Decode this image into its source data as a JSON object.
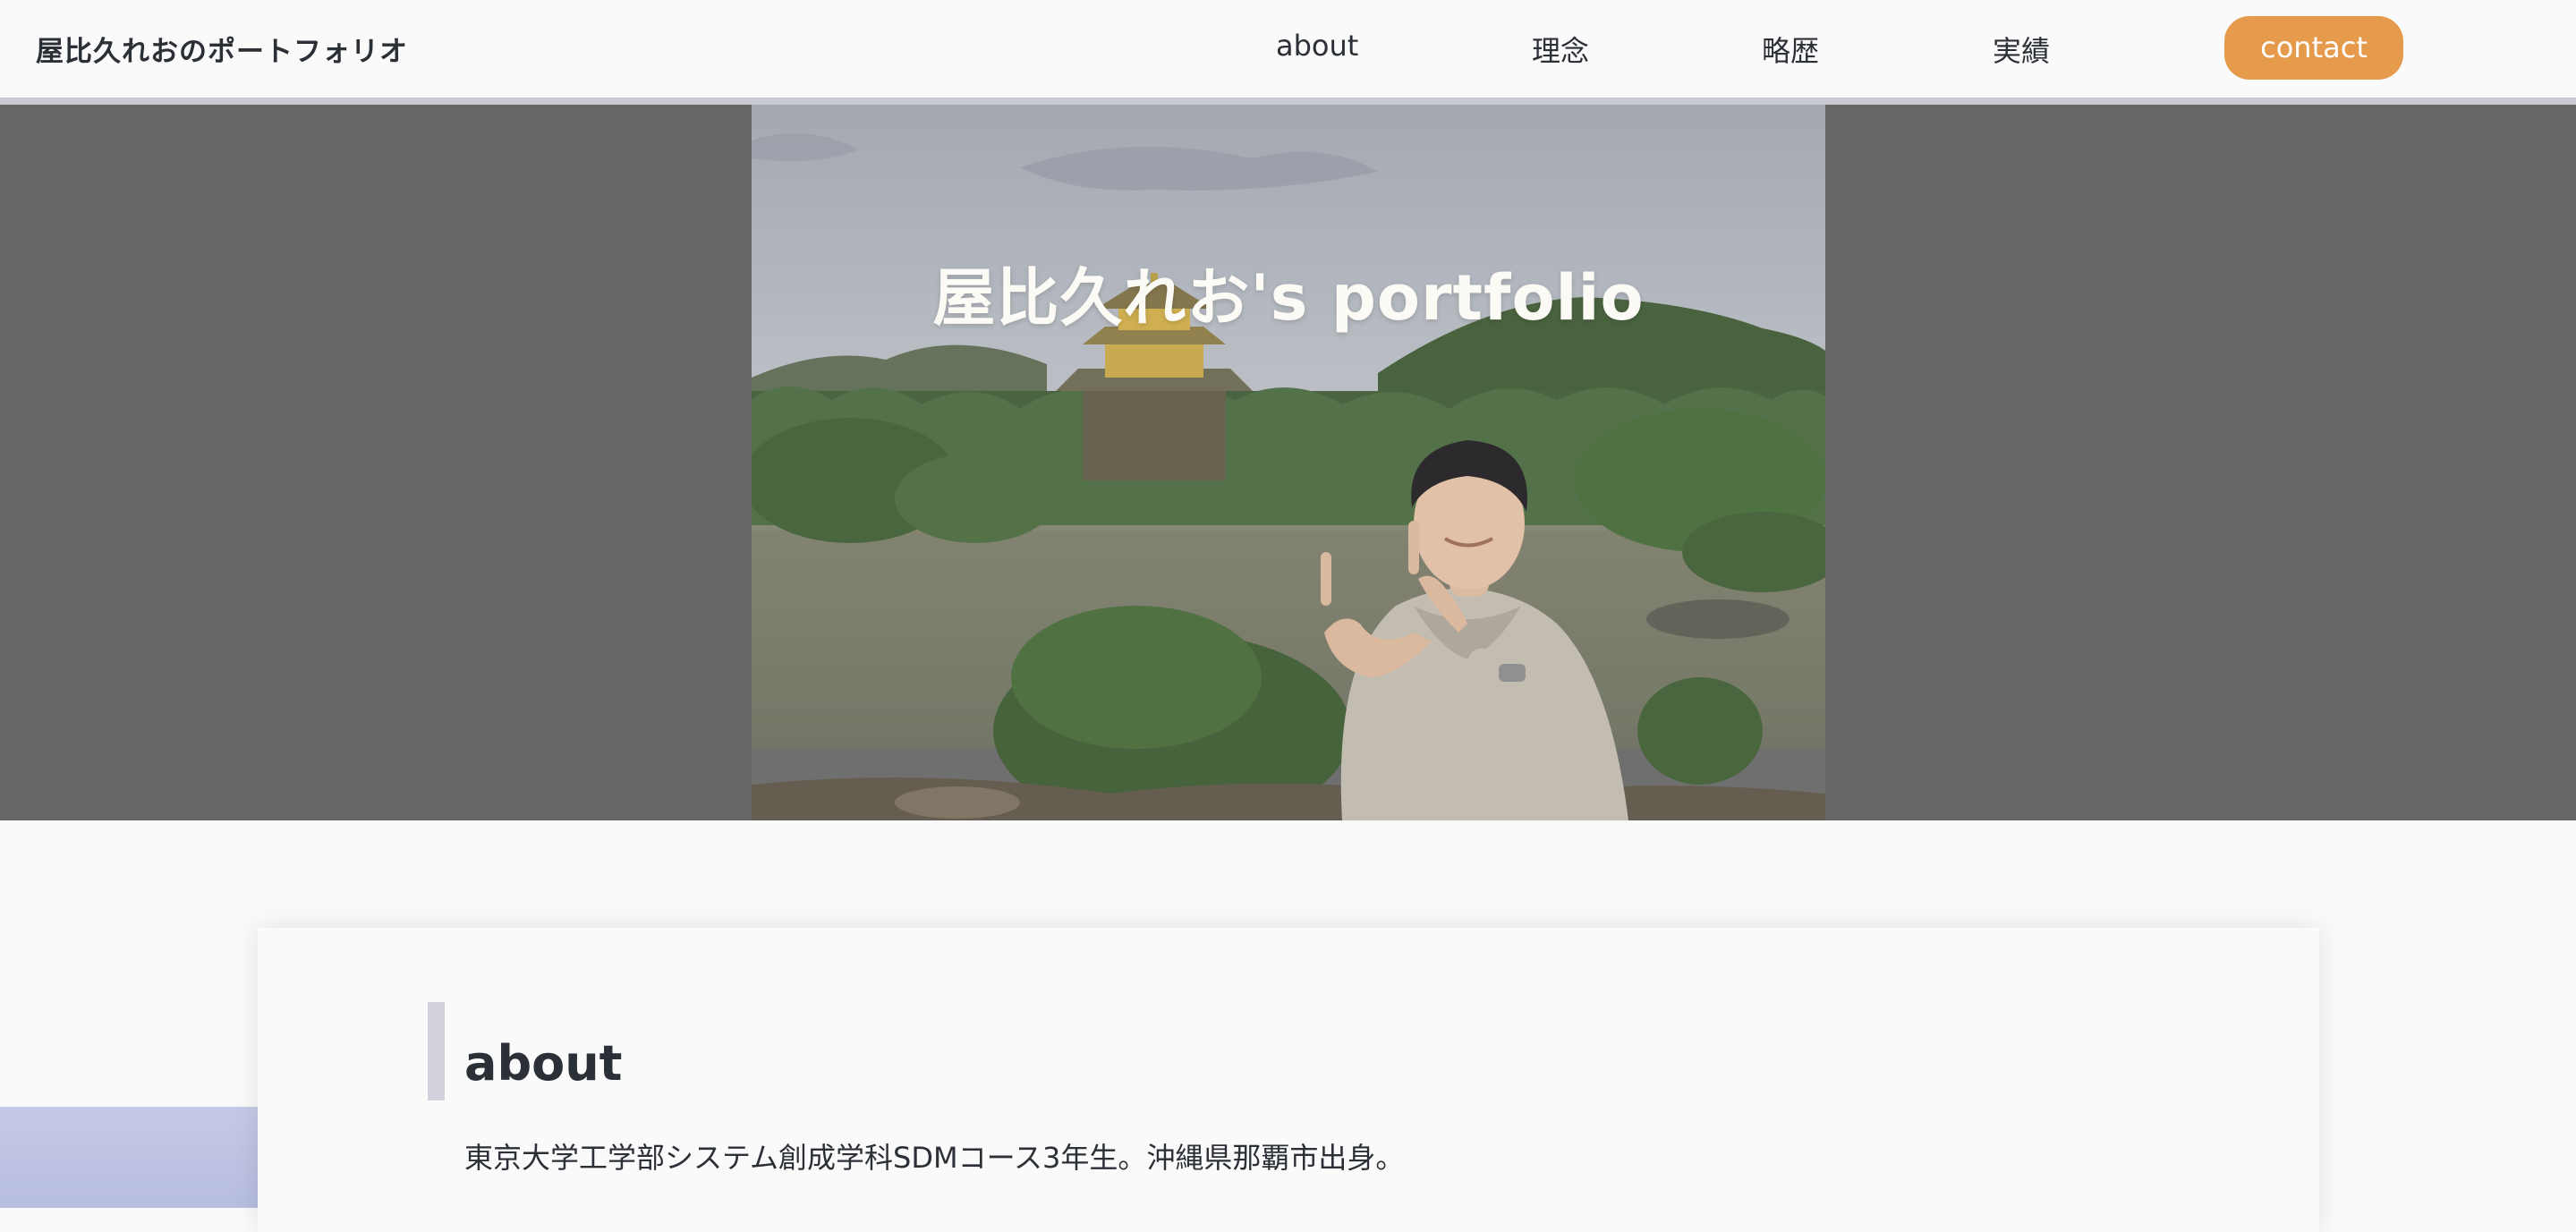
{
  "header": {
    "site_title": "屋比久れおのポートフォリオ",
    "nav": {
      "about": "about",
      "rinen": "理念",
      "ryakureki": "略歴",
      "jisseki": "実績"
    },
    "contact_label": "contact"
  },
  "hero": {
    "title": "屋比久れお's portfolio",
    "photo_icon": "portrait-photo-kinkakuji"
  },
  "about": {
    "heading": "about",
    "text": "東京大学工学部システム創成学科SDMコース3年生。沖縄県那覇市出身。"
  },
  "colors": {
    "accent": "#e69a4c",
    "hero_bg": "#666666",
    "text": "#2b2f36",
    "page_bg": "#fafafa",
    "decor_block": "#c4c8e6",
    "divider": "#c9c9d3"
  }
}
